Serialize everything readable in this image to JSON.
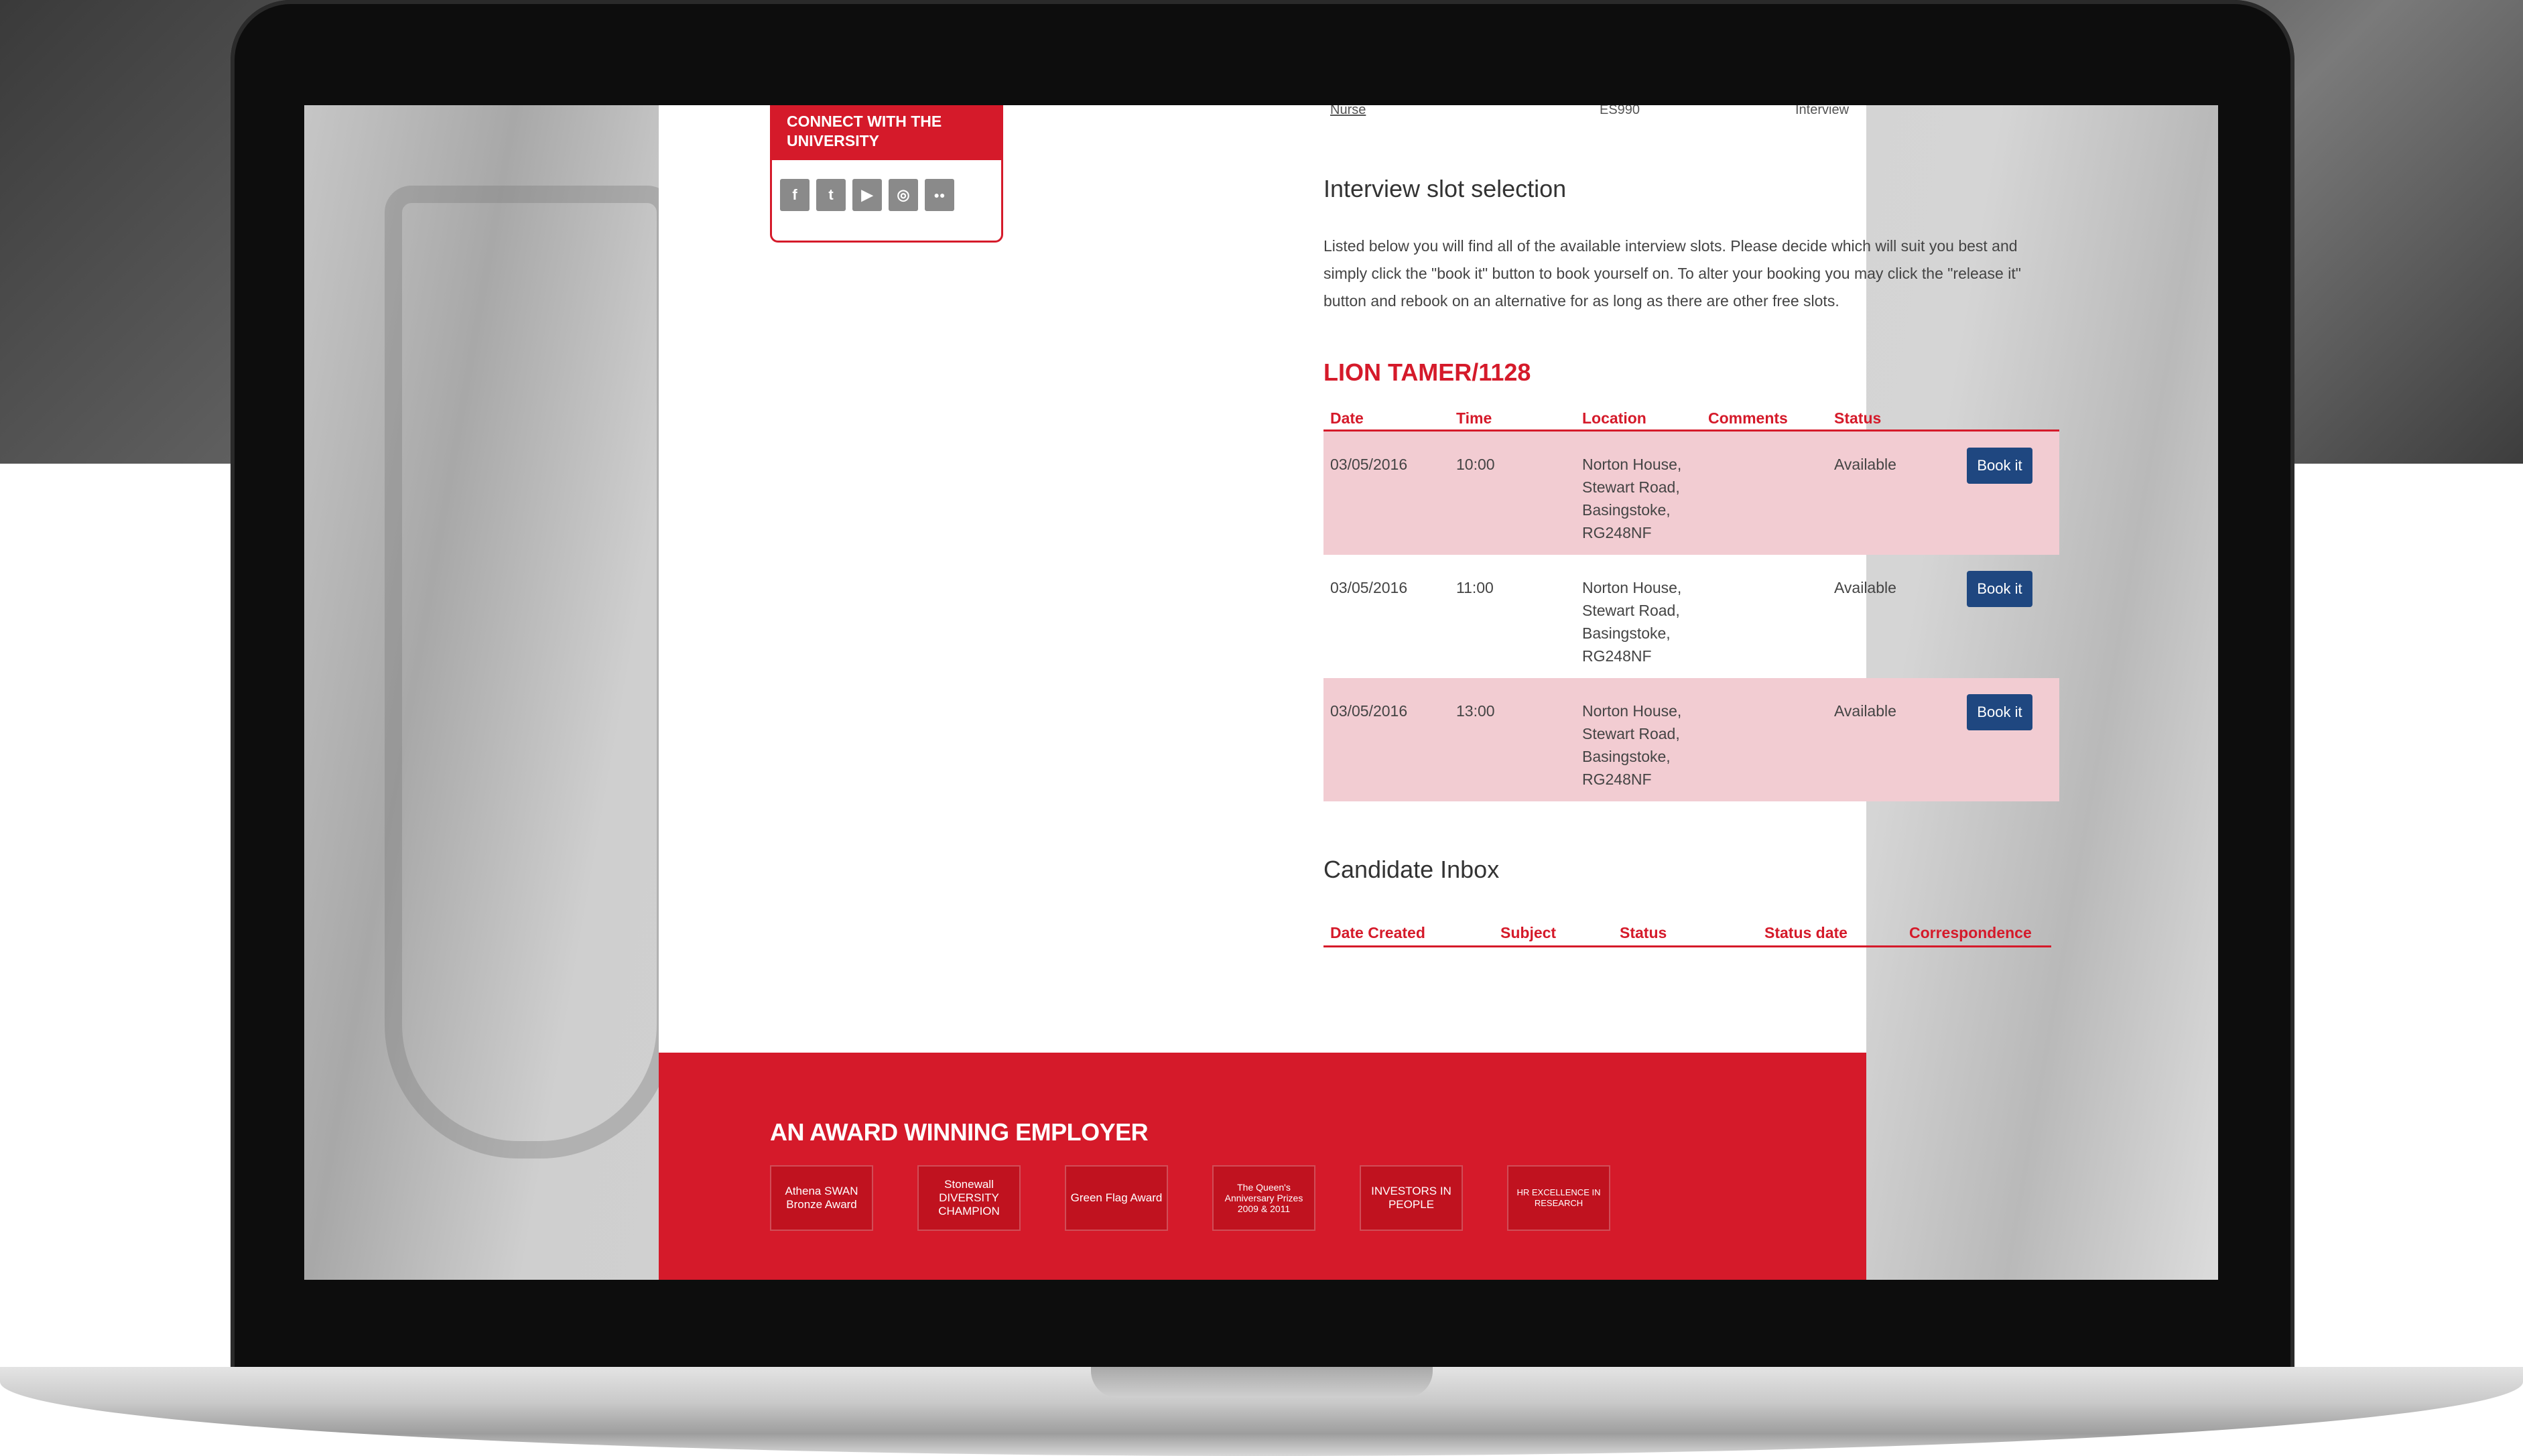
{
  "sidebar": {
    "connect_title": "CONNECT WITH THE UNIVERSITY",
    "social_icons": [
      "facebook-icon",
      "twitter-icon",
      "youtube-icon",
      "instagram-icon",
      "flickr-icon"
    ],
    "social_glyphs": [
      "f",
      "t",
      "▶",
      "◎",
      "●●"
    ]
  },
  "previous_row": {
    "role": "Nurse",
    "reference": "ES990",
    "stage": "Interview"
  },
  "interview": {
    "heading": "Interview slot selection",
    "intro": "Listed below you will find all of the available interview slots. Please decide which will suit you best and simply click the \"book it\" button to book yourself on. To alter your booking you may click the \"release it\" button and rebook on an alternative for as long as there are other free slots.",
    "job_title": "LION TAMER/1128",
    "columns": [
      "Date",
      "Time",
      "Location",
      "Comments",
      "Status"
    ],
    "slots": [
      {
        "date": "03/05/2016",
        "time": "10:00",
        "location": [
          "Norton House,",
          "Stewart Road,",
          "Basingstoke,",
          "RG248NF"
        ],
        "comments": "",
        "status": "Available",
        "button": "Book it"
      },
      {
        "date": "03/05/2016",
        "time": "11:00",
        "location": [
          "Norton House,",
          "Stewart Road,",
          "Basingstoke,",
          "RG248NF"
        ],
        "comments": "",
        "status": "Available",
        "button": "Book it"
      },
      {
        "date": "03/05/2016",
        "time": "13:00",
        "location": [
          "Norton House,",
          "Stewart Road,",
          "Basingstoke,",
          "RG248NF"
        ],
        "comments": "",
        "status": "Available",
        "button": "Book it"
      }
    ]
  },
  "inbox": {
    "heading": "Candidate Inbox",
    "columns": [
      "Date Created",
      "Subject",
      "Status",
      "Status date",
      "Correspondence"
    ]
  },
  "footer": {
    "title": "AN AWARD WINNING EMPLOYER",
    "awards": [
      "Athena SWAN Bronze Award",
      "Stonewall DIVERSITY CHAMPION",
      "Green Flag Award",
      "The Queen's Anniversary Prizes 2009 & 2011",
      "INVESTORS IN PEOPLE",
      "HR EXCELLENCE IN RESEARCH"
    ]
  },
  "colors": {
    "brand_red": "#d51a2a",
    "row_pink": "#f2ccd2",
    "button_blue": "#1f4780"
  }
}
